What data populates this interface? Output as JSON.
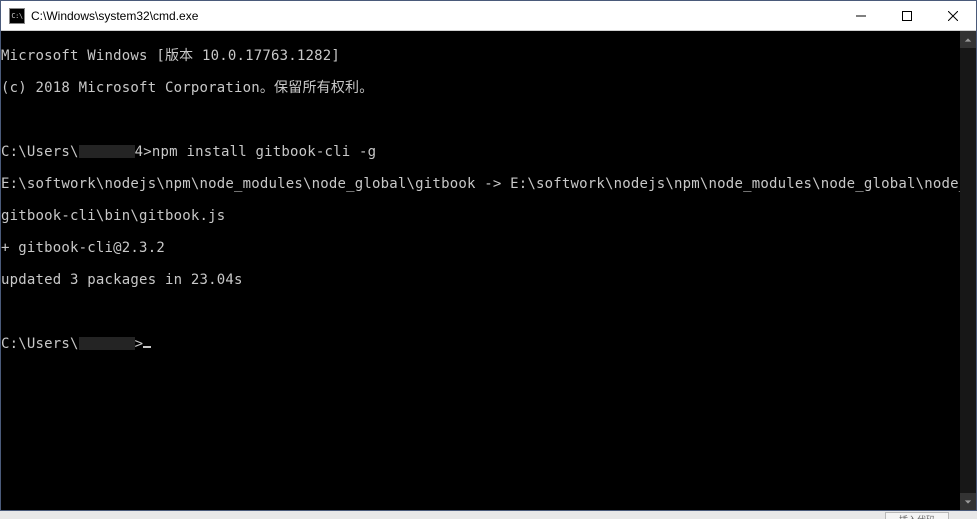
{
  "window": {
    "icon_label": "C:\\",
    "title": "C:\\Windows\\system32\\cmd.exe"
  },
  "terminal": {
    "l1": "Microsoft Windows [版本 10.0.17763.1282]",
    "l2": "(c) 2018 Microsoft Corporation。保留所有权利。",
    "l3": "",
    "l4a": "C:\\Users\\",
    "l4b": "4>npm install gitbook-cli -g",
    "l5": "E:\\softwork\\nodejs\\npm\\node_modules\\node_global\\gitbook -> E:\\softwork\\nodejs\\npm\\node_modules\\node_global\\node_modules\\",
    "l6": "gitbook-cli\\bin\\gitbook.js",
    "l7": "+ gitbook-cli@2.3.2",
    "l8": "updated 3 packages in 23.04s",
    "l9": "",
    "l10a": "C:\\Users\\",
    "l10b": ">"
  },
  "bottom": {
    "hint": "插入代码"
  }
}
